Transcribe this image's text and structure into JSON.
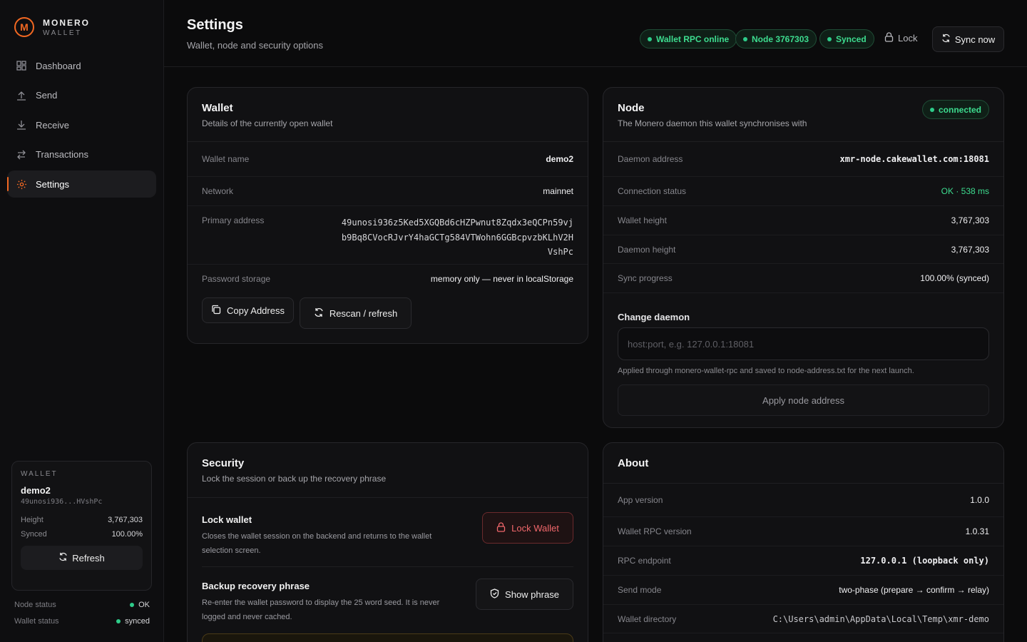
{
  "brand": {
    "logo": "M",
    "line1": "MONERO",
    "line2": "WALLET"
  },
  "nav": [
    {
      "label": "Dashboard",
      "icon": "dashboard-icon"
    },
    {
      "label": "Send",
      "icon": "send-icon"
    },
    {
      "label": "Receive",
      "icon": "receive-icon"
    },
    {
      "label": "Transactions",
      "icon": "transactions-icon"
    },
    {
      "label": "Settings",
      "icon": "gear-icon",
      "active": true
    }
  ],
  "wallet_card": {
    "label": "WALLET",
    "name": "demo2",
    "address_short": "49unosi936...HVshPc",
    "height_label": "Height",
    "height": "3,767,303",
    "synced_label": "Synced",
    "synced": "100.00%",
    "refresh": "Refresh"
  },
  "status": {
    "node_label": "Node status",
    "node_value": "OK",
    "wallet_label": "Wallet status",
    "wallet_value": "synced"
  },
  "header": {
    "title": "Settings",
    "subtitle": "Wallet, node and security options",
    "pills": [
      "Wallet RPC online",
      "Node 3767303",
      "Synced"
    ],
    "lock": "Lock",
    "sync": "Sync now"
  },
  "wallet": {
    "title": "Wallet",
    "desc": "Details of the currently open wallet",
    "name_label": "Wallet name",
    "name": "demo2",
    "network_label": "Network",
    "network": "mainnet",
    "address_label": "Primary address",
    "address_lines": [
      "49unosi936z5Ked5XGQBd6cHZPwnut8Zqdx3eQCPn59vj",
      "b9Bq8CVocRJvrY4haGCTg584VTWohn6GGBcpvzbKLhV2H",
      "VshPc"
    ],
    "password_label": "Password storage",
    "password": "memory only — never in localStorage",
    "copy": "Copy Address",
    "rescan": "Rescan / refresh"
  },
  "node": {
    "title": "Node",
    "desc": "The Monero daemon this wallet synchronises with",
    "badge": "connected",
    "daemon_label": "Daemon address",
    "daemon": "xmr-node.cakewallet.com:18081",
    "conn_label": "Connection status",
    "conn": "OK · 538 ms",
    "wheight_label": "Wallet height",
    "wheight": "3,767,303",
    "dheight_label": "Daemon height",
    "dheight": "3,767,303",
    "sync_label": "Sync progress",
    "sync": "100.00% (synced)",
    "change_label": "Change daemon",
    "placeholder": "host:port, e.g. 127.0.0.1:18081",
    "hint": "Applied through monero-wallet-rpc and saved to node-address.txt for the next launch.",
    "apply": "Apply node address"
  },
  "security": {
    "title": "Security",
    "desc": "Lock the session or back up the recovery phrase",
    "lock_title": "Lock wallet",
    "lock_desc": "Closes the wallet session on the backend and returns to the wallet selection screen.",
    "lock_btn": "Lock Wallet",
    "backup_title": "Backup recovery phrase",
    "backup_desc": "Re-enter the wallet password to display the 25 word seed. It is never logged and never cached.",
    "backup_btn": "Show phrase"
  },
  "about": {
    "title": "About",
    "app_label": "App version",
    "app": "1.0.0",
    "rpc_label": "Wallet RPC version",
    "rpc": "1.0.31",
    "endpoint_label": "RPC endpoint",
    "endpoint": "127.0.0.1 (loopback only)",
    "send_label": "Send mode",
    "send": "two-phase (prepare → confirm → relay)",
    "dir_label": "Wallet directory",
    "dir": "C:\\Users\\admin\\AppData\\Local\\Temp\\xmr-demo"
  },
  "colors": {
    "accent": "#f26822",
    "success": "#3ddc8f",
    "danger": "#e5484d"
  }
}
